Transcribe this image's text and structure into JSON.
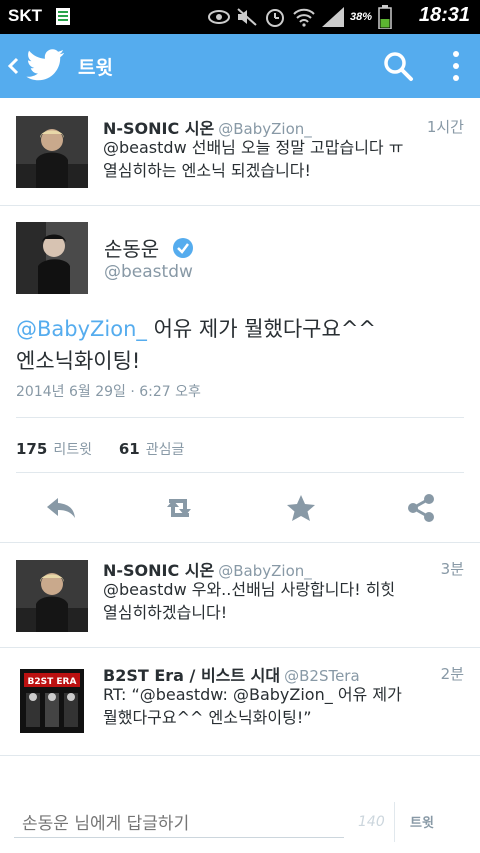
{
  "status_bar": {
    "carrier": "SKT",
    "battery_percent": "38%",
    "time": "18:31"
  },
  "action_bar": {
    "title": "트윗",
    "color": "#55acee"
  },
  "reply_above": {
    "name": "N-SONIC 시온",
    "handle": "@BabyZion_",
    "time": "1시간",
    "text_line1": "@beastdw 선배님 오늘 정말 고맙습니다 ㅠ",
    "text_line2": "열심히하는 엔소닉 되겠습니다!"
  },
  "main_tweet": {
    "name": "손동운",
    "handle": "@beastdw",
    "mention": "@BabyZion_",
    "text_rest": " 어유 제가 뭘했다구요^^",
    "text_line2": "엔소닉화이팅!",
    "date": "2014년 6월 29일 · 6:27 오후",
    "retweet_count": "175",
    "retweet_label": "리트윗",
    "favorite_count": "61",
    "favorite_label": "관심글"
  },
  "replies": [
    {
      "name": "N-SONIC 시온",
      "handle": "@BabyZion_",
      "time": "3분",
      "text_line1": "@beastdw 우와..선배님 사랑합니다! 히힛",
      "text_line2": "열심히하겠습니다!"
    },
    {
      "name": "B2ST Era / 비스트 시대",
      "handle": "@B2STera",
      "time": "2분",
      "text_line1": "RT: “@beastdw: @BabyZion_ 어유 제가",
      "text_line2": "뭘했다구요^^ 엔소닉화이팅!”",
      "avatar_text": "B2ST ERA"
    }
  ],
  "reply_box": {
    "placeholder": "손동운 님에게 답글하기",
    "char_count": "140",
    "button_label": "트윗"
  }
}
